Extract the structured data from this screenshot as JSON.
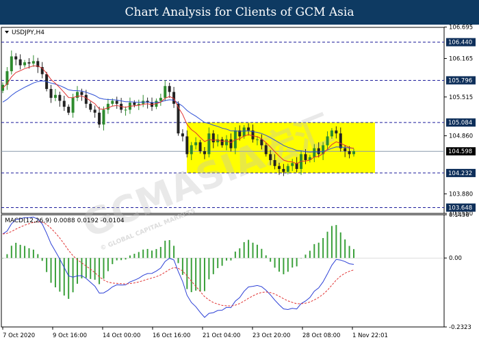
{
  "header": {
    "title": "Chart Analysis for Clients of GCM Asia"
  },
  "watermark": {
    "text": "GCMASIA宏汇",
    "subtext": "© GLOBAL CAPITAL MARKETS"
  },
  "colors": {
    "header_bg": "#0e3a62",
    "bull_candle": "#2e8b2e",
    "bear_candle": "#222222",
    "ma_fast": "#e03030",
    "ma_slow": "#2d4fd6",
    "level_line": "#1a1a9a",
    "highlight_box": "#ffff00",
    "price_badge": "#0e2f5a",
    "macd_hist": "#3aa03a",
    "macd_line": "#2b3fd6",
    "signal_line": "#e03030"
  },
  "chart_data": [
    {
      "type": "candlestick",
      "symbol_label": "USDJPY,H4",
      "current_price": 104.598,
      "ylim": [
        103.55,
        106.69
      ],
      "y_ticks": [
        "106.695",
        "106.440",
        "106.165",
        "105.796",
        "105.515",
        "105.084",
        "104.860",
        "104.598",
        "104.232",
        "103.880",
        "103.648",
        "103.550"
      ],
      "x_ticks": [
        "7 Oct 2020",
        "9 Oct 16:00",
        "14 Oct 00:00",
        "16 Oct 16:00",
        "21 Oct 04:00",
        "23 Oct 20:00",
        "28 Oct 08:00",
        "1 Nov 22:01"
      ],
      "levels": [
        106.44,
        105.796,
        105.084,
        104.232,
        103.648
      ],
      "range_box": {
        "top": 105.084,
        "bottom": 104.232
      },
      "close_series": [
        105.72,
        105.95,
        106.2,
        106.15,
        106.05,
        106.1,
        106.08,
        106.12,
        106.02,
        105.9,
        105.65,
        105.5,
        105.55,
        105.45,
        105.35,
        105.25,
        105.5,
        105.6,
        105.55,
        105.4,
        105.3,
        105.25,
        105.05,
        105.3,
        105.4,
        105.45,
        105.4,
        105.3,
        105.3,
        105.42,
        105.38,
        105.4,
        105.45,
        105.42,
        105.35,
        105.45,
        105.5,
        105.7,
        105.6,
        105.4,
        104.9,
        104.85,
        104.55,
        104.7,
        104.75,
        104.6,
        104.55,
        104.9,
        104.75,
        104.8,
        104.7,
        104.8,
        104.65,
        104.95,
        104.85,
        105.0,
        104.95,
        104.8,
        104.8,
        104.7,
        104.55,
        104.45,
        104.35,
        104.3,
        104.25,
        104.35,
        104.4,
        104.3,
        104.55,
        104.45,
        104.5,
        104.65,
        104.55,
        104.7,
        104.85,
        104.95,
        104.9,
        104.65,
        104.6,
        104.55,
        104.6
      ],
      "ma_fast_start": 105.65,
      "ma_slow_start": 105.4
    },
    {
      "type": "macd",
      "label": "MACD(12,26,9) 0.0088 0.0192 -0.0104",
      "params": [
        12,
        26,
        9
      ],
      "values": {
        "macd": 0.0088,
        "signal": 0.0192,
        "histogram": -0.0104
      },
      "ylim": [
        -0.2323,
        0.1456
      ],
      "y_ticks": [
        "0.1456",
        "0.00",
        "-0.2323"
      ]
    }
  ]
}
